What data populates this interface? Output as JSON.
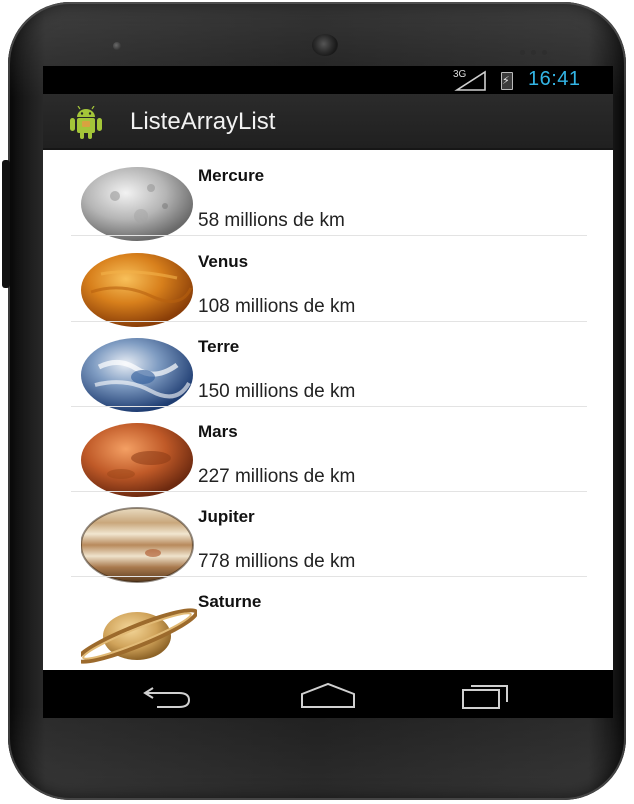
{
  "status_bar": {
    "network": "3G",
    "time": "16:41",
    "accent_color": "#33b5e5"
  },
  "action_bar": {
    "title": "ListeArrayList",
    "icon": "android-icon"
  },
  "planets": [
    {
      "name": "Mercure",
      "distance": "58 millions de km",
      "icon": "mercury-image"
    },
    {
      "name": "Venus",
      "distance": "108 millions de km",
      "icon": "venus-image"
    },
    {
      "name": "Terre",
      "distance": "150 millions de km",
      "icon": "earth-image"
    },
    {
      "name": "Mars",
      "distance": "227 millions de km",
      "icon": "mars-image"
    },
    {
      "name": "Jupiter",
      "distance": "778 millions de km",
      "icon": "jupiter-image"
    },
    {
      "name": "Saturne",
      "distance": "",
      "icon": "saturn-image"
    }
  ],
  "nav_bar": {
    "buttons": [
      "back-icon",
      "home-icon",
      "recent-apps-icon"
    ]
  }
}
